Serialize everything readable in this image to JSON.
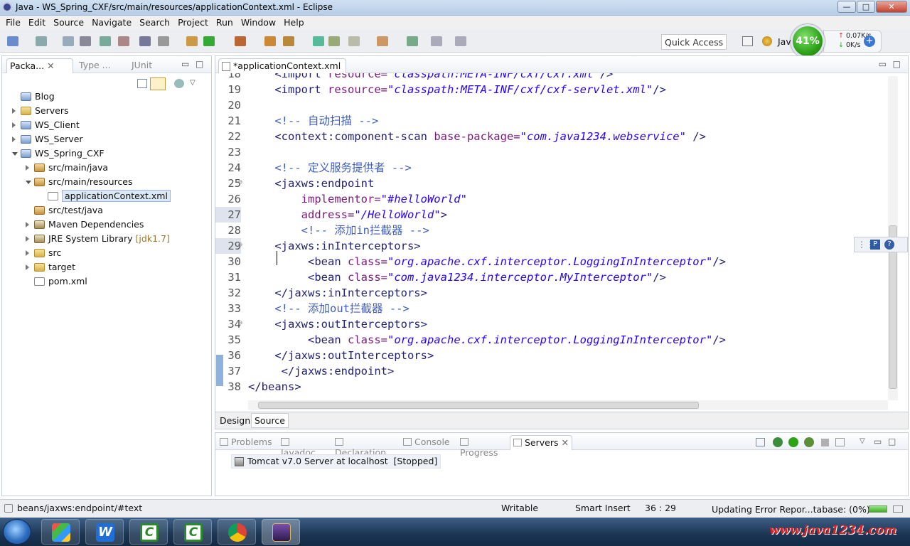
{
  "window": {
    "title": "Java - WS_Spring_CXF/src/main/resources/applicationContext.xml - Eclipse",
    "min": "—",
    "max": "□",
    "close": "✕"
  },
  "menu": [
    "File",
    "Edit",
    "Source",
    "Navigate",
    "Search",
    "Project",
    "Run",
    "Window",
    "Help"
  ],
  "toolbar": {
    "quick_access": "Quick Access",
    "perspective": "Java"
  },
  "meter": {
    "percent": "41%",
    "up": "0.07K/s",
    "down": "0K/s"
  },
  "explorer": {
    "tabs": [
      "Packa...",
      "Type ...",
      "JUnit"
    ],
    "items": [
      {
        "label": "Blog",
        "icon": "proj",
        "level": 0,
        "arrow": "none"
      },
      {
        "label": "Servers",
        "icon": "fold",
        "level": 0,
        "arrow": "closed"
      },
      {
        "label": "WS_Client",
        "icon": "proj",
        "level": 0,
        "arrow": "closed"
      },
      {
        "label": "WS_Server",
        "icon": "proj",
        "level": 0,
        "arrow": "closed"
      },
      {
        "label": "WS_Spring_CXF",
        "icon": "proj",
        "level": 0,
        "arrow": "open"
      },
      {
        "label": "src/main/java",
        "icon": "pkg",
        "level": 1,
        "arrow": "closed"
      },
      {
        "label": "src/main/resources",
        "icon": "pkg",
        "level": 1,
        "arrow": "open"
      },
      {
        "label": "applicationContext.xml",
        "icon": "xmlf",
        "level": 2,
        "arrow": "none",
        "selected": true
      },
      {
        "label": "src/test/java",
        "icon": "pkg",
        "level": 1,
        "arrow": "none"
      },
      {
        "label": "Maven Dependencies",
        "icon": "jar",
        "level": 1,
        "arrow": "closed"
      },
      {
        "label": "JRE System Library",
        "suffix": "[jdk1.7]",
        "icon": "jar",
        "level": 1,
        "arrow": "closed"
      },
      {
        "label": "src",
        "icon": "fold",
        "level": 1,
        "arrow": "closed"
      },
      {
        "label": "target",
        "icon": "fold",
        "level": 1,
        "arrow": "closed"
      },
      {
        "label": "pom.xml",
        "icon": "xmlf",
        "level": 1,
        "arrow": "none"
      }
    ]
  },
  "editor": {
    "tab": "*applicationContext.xml",
    "bottom_tabs": [
      "Design",
      "Source"
    ],
    "lines": [
      {
        "n": "18",
        "html": "    <span class='tg'>&lt;import</span> <span class='at'>resource=</span><span class='st'>\"classpath:META-INF/cxf/cxf.xml\"</span><span class='tg'>/&gt;</span>"
      },
      {
        "n": "19",
        "html": "    <span class='tg'>&lt;import</span> <span class='at'>resource=</span><span class='st'>\"classpath:META-INF/cxf/cxf-servlet.xml\"</span><span class='tg'>/&gt;</span>"
      },
      {
        "n": "20",
        "html": ""
      },
      {
        "n": "21",
        "html": "    <span class='cm'>&lt;!-- 自动扫描 --&gt;</span>"
      },
      {
        "n": "22",
        "html": "    <span class='tg'>&lt;context:component-scan</span> <span class='at'>base-package=</span><span class='st'>\"com.java1234.webservice\"</span> <span class='tg'>/&gt;</span>"
      },
      {
        "n": "23",
        "html": ""
      },
      {
        "n": "24",
        "html": "    <span class='cm'>&lt;!-- 定义服务提供者 --&gt;</span>"
      },
      {
        "n": "25",
        "html": "    <span class='tg'>&lt;jaxws:endpoint</span>"
      },
      {
        "n": "26",
        "html": "        <span class='at'>implementor=</span><span class='st'>\"#helloWorld\"</span>"
      },
      {
        "n": "27",
        "html": "        <span class='at'>address=</span><span class='st'>\"/HelloWorld\"</span><span class='tg'>&gt;</span>"
      },
      {
        "n": "28",
        "html": "        <span class='cm'>&lt;!-- 添加in拦截器 --&gt;</span>"
      },
      {
        "n": "29",
        "html": "    <span class='tg'>&lt;jaxws:inInterceptors&gt;</span>"
      },
      {
        "n": "30",
        "html": "         <span class='tg'>&lt;bean</span> <span class='at'>class=</span><span class='st'>\"org.apache.cxf.interceptor.LoggingInInterceptor\"</span><span class='tg'>/&gt;</span>"
      },
      {
        "n": "31",
        "html": "         <span class='tg'>&lt;bean</span> <span class='at'>class=</span><span class='st'>\"com.java1234.interceptor.MyInterceptor\"</span><span class='tg'>/&gt;</span>"
      },
      {
        "n": "32",
        "html": "    <span class='tg'>&lt;/jaxws:inInterceptors&gt;</span>"
      },
      {
        "n": "33",
        "html": "    <span class='cm'>&lt;!-- 添加out拦截器 --&gt;</span>"
      },
      {
        "n": "34",
        "html": "    <span class='tg'>&lt;jaxws:outInterceptors&gt;</span>"
      },
      {
        "n": "35",
        "html": "         <span class='tg'>&lt;bean</span> <span class='at'>class=</span><span class='st'>\"org.apache.cxf.interceptor.LoggingInInterceptor\"</span><span class='tg'>/&gt;</span>"
      },
      {
        "n": "36",
        "html": "    <span class='tg'>&lt;/jaxws:outInterceptors&gt;</span>"
      },
      {
        "n": "37",
        "html": "     <span class='tg'>&lt;/jaxws:endpoint&gt;</span>"
      },
      {
        "n": "38",
        "html": "<span class='tg'>&lt;/beans&gt;</span>"
      }
    ]
  },
  "bottom_panel": {
    "tabs": [
      "Problems",
      "Javadoc",
      "Declaration",
      "Console",
      "Progress",
      "Servers"
    ],
    "active_tab": "Servers",
    "server_row": "Tomcat v7.0 Server at localhost  [Stopped]"
  },
  "status": {
    "path": "beans/jaxws:endpoint/#text",
    "writable": "Writable",
    "insert_mode": "Smart Insert",
    "position": "36 : 29",
    "job": "Updating Error Repor...tabase: (0%)"
  },
  "taskbar": {
    "watermark": "www.java1234.com"
  }
}
